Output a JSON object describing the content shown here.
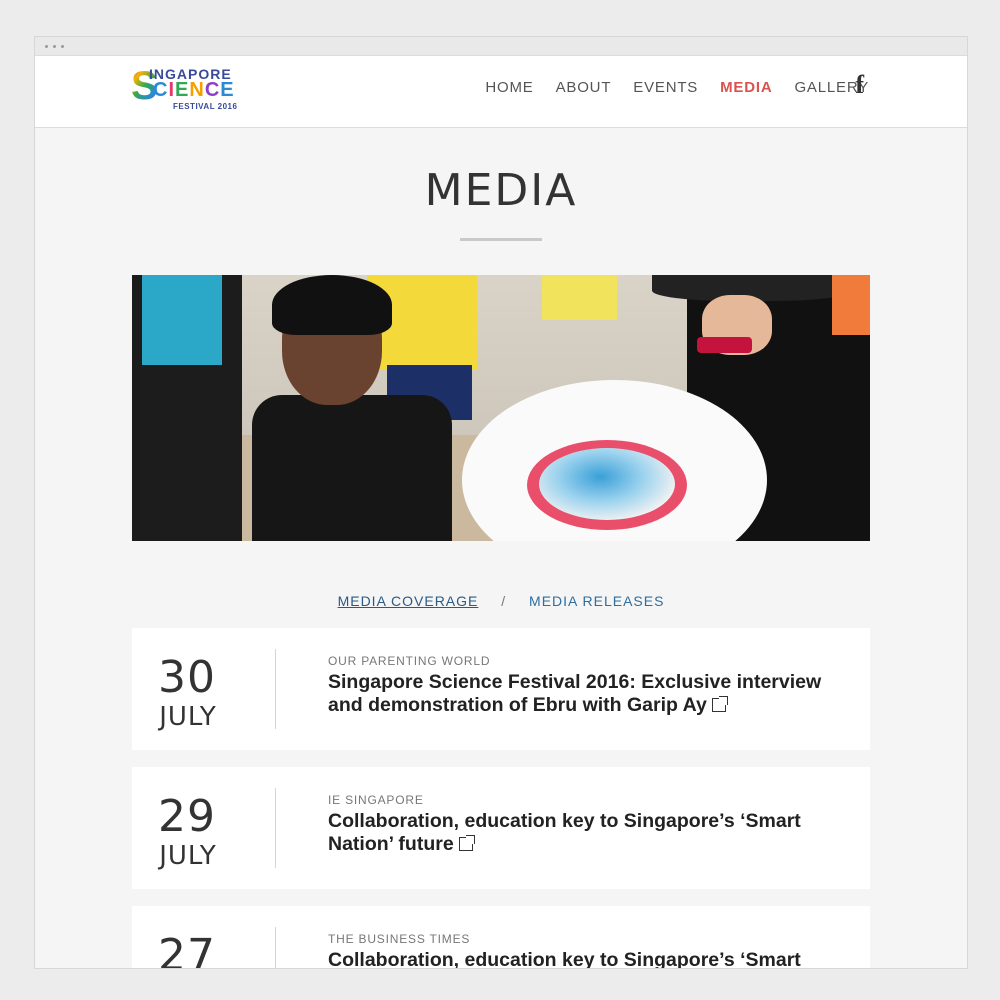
{
  "logo": {
    "line1": "INGAPORE",
    "big_s": "S",
    "line2": [
      "C",
      "I",
      "E",
      "N",
      "C",
      "E"
    ],
    "line3": "FESTIVAL 2016"
  },
  "nav": {
    "items": [
      {
        "label": "HOME",
        "active": false
      },
      {
        "label": "ABOUT",
        "active": false
      },
      {
        "label": "EVENTS",
        "active": false
      },
      {
        "label": "MEDIA",
        "active": true
      },
      {
        "label": "GALLERY",
        "active": false
      }
    ],
    "facebook_icon": "f"
  },
  "page": {
    "title": "MEDIA"
  },
  "tabs": {
    "coverage": "MEDIA COVERAGE",
    "separator": "/",
    "releases": "MEDIA RELEASES"
  },
  "articles": [
    {
      "day": "30",
      "month": "JULY",
      "source": "OUR PARENTING WORLD",
      "headline": "Singapore Science Festival 2016: Exclusive interview and demonstration of Ebru with Garip Ay"
    },
    {
      "day": "29",
      "month": "JULY",
      "source": "IE SINGAPORE",
      "headline": "Collaboration, education key to Singapore’s ‘Smart Nation’ future"
    },
    {
      "day": "27",
      "month": "",
      "source": "THE BUSINESS TIMES",
      "headline": "Collaboration, education key to Singapore’s ‘Smart"
    }
  ],
  "colors": {
    "accent_active": "#d9534f",
    "link": "#2f6ea0",
    "background": "#f5f5f5"
  }
}
